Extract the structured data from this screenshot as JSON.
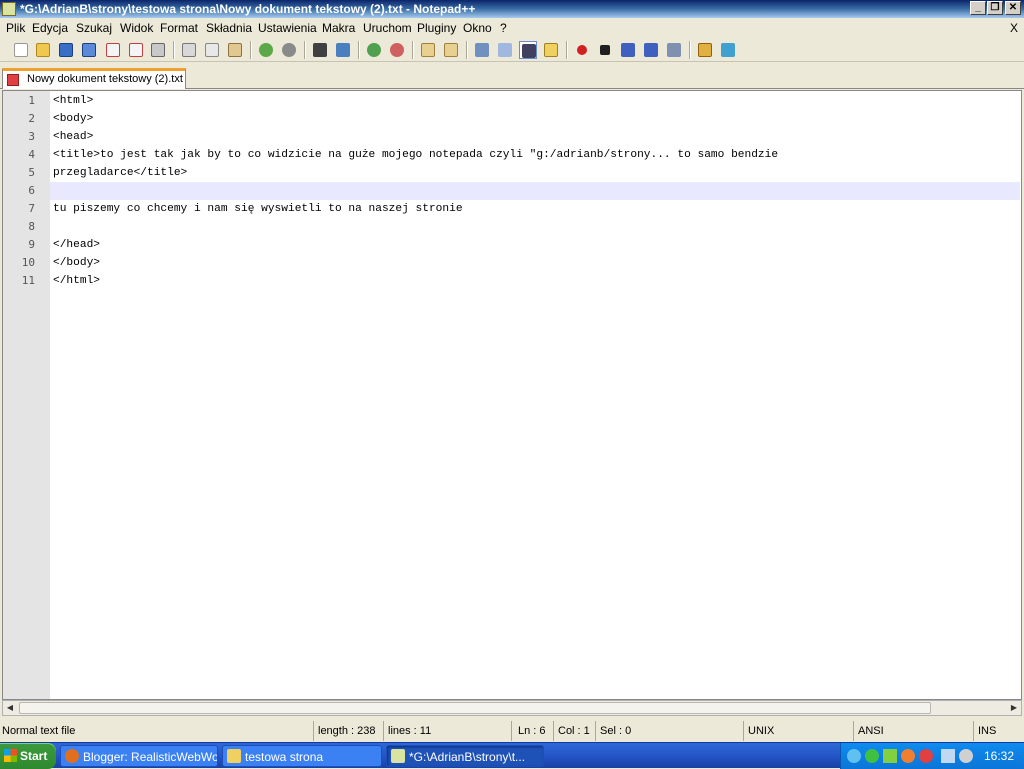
{
  "window": {
    "title": "*G:\\AdrianB\\strony\\testowa strona\\Nowy dokument tekstowy (2).txt - Notepad++",
    "min_symbol": "_",
    "max_symbol": "❐",
    "close_symbol": "✕"
  },
  "menu": {
    "items": [
      "Plik",
      "Edycja",
      "Szukaj",
      "Widok",
      "Format",
      "Składnia",
      "Ustawienia",
      "Makra",
      "Uruchom",
      "Pluginy",
      "Okno",
      "?"
    ],
    "doc_close": "X"
  },
  "toolbar": {
    "icons": [
      "new-icon",
      "open-icon",
      "save-icon",
      "save-all-icon",
      "close-icon",
      "close-all-icon",
      "print-icon",
      "cut-icon",
      "copy-icon",
      "paste-icon",
      "undo-icon",
      "redo-icon",
      "find-icon",
      "replace-icon",
      "zoom-in-icon",
      "zoom-out-icon",
      "sync-vertical-icon",
      "sync-horizontal-icon",
      "word-wrap-icon",
      "show-all-chars-icon",
      "indent-guide-icon",
      "user-language-icon",
      "record-macro-icon",
      "stop-macro-icon",
      "play-macro-icon",
      "run-macro-multiple-icon",
      "save-macro-icon",
      "open-folder-icon",
      "spellcheck-icon"
    ]
  },
  "tab": {
    "label": "Nowy dokument tekstowy (2).txt"
  },
  "editor": {
    "line_numbers": [
      "1",
      "2",
      "3",
      "4",
      "5",
      "6",
      "7",
      "8",
      "9",
      "10",
      "11"
    ],
    "lines": [
      "<html>",
      "<body>",
      "<head>",
      "<title>to jest tak jak by to co widzicie na guże mojego notepada czyli \"g:/adrianb/strony... to samo bendzie",
      "przegladarce</title>",
      "",
      "tu piszemy co chcemy i nam się wyswietli to na naszej stronie",
      "",
      "</head>",
      "</body>",
      "</html>"
    ],
    "current_line": 6
  },
  "scrollbar": {
    "left_arrow": "◀",
    "right_arrow": "▶"
  },
  "status": {
    "file_type": "Normal text file",
    "length": "length : 238",
    "lines": "lines : 11",
    "ln": "Ln : 6",
    "col": "Col : 1",
    "sel": "Sel : 0",
    "eol": "UNIX",
    "encoding": "ANSI",
    "mode": "INS"
  },
  "taskbar": {
    "start": "Start",
    "tasks": [
      {
        "label": "Blogger: RealisticWebWo...",
        "icon": "firefox-icon"
      },
      {
        "label": "testowa strona",
        "icon": "folder-icon"
      },
      {
        "label": "*G:\\AdrianB\\strony\\t...",
        "icon": "notepad-icon"
      }
    ],
    "clock": "16:32"
  }
}
